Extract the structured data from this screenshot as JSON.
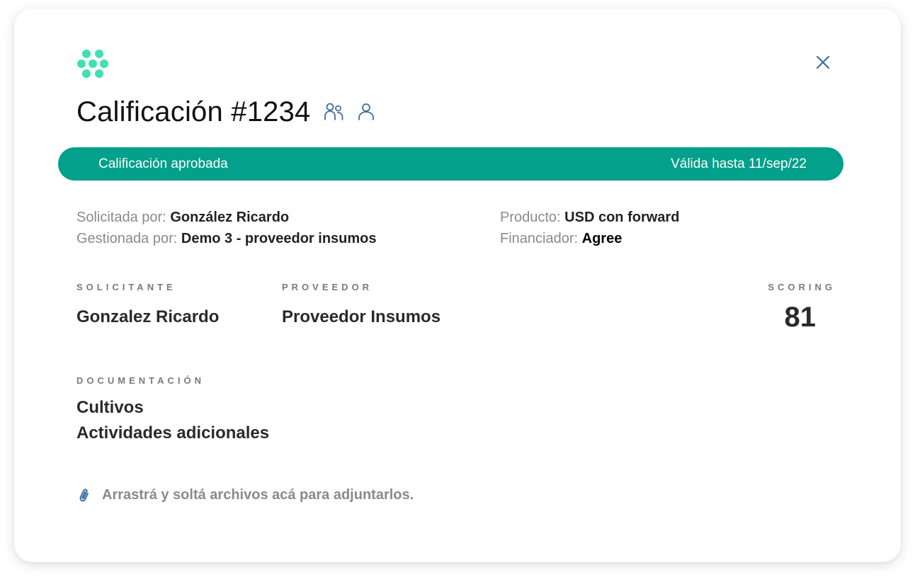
{
  "header": {
    "title": "Calificación #1234",
    "icons": [
      "logo-icon",
      "users-icon",
      "user-icon",
      "close-icon"
    ]
  },
  "status": {
    "label": "Calificación aprobada",
    "validity": "Válida hasta 11/sep/22",
    "color": "#03a08b"
  },
  "meta": {
    "requested_by_label": "Solicitada por:",
    "requested_by_value": "González Ricardo",
    "managed_by_label": "Gestionada por:",
    "managed_by_value": "Demo 3 - proveedor insumos",
    "product_label": "Producto:",
    "product_value": "USD con forward",
    "financer_label": "Financiador:",
    "financer_value": "Agree"
  },
  "parties": {
    "applicant_label": "SOLICITANTE",
    "applicant_value": "Gonzalez Ricardo",
    "provider_label": "PROVEEDOR",
    "provider_value": "Proveedor Insumos",
    "scoring_label": "SCORING",
    "scoring_value": "81"
  },
  "documentation": {
    "label": "DOCUMENTACIÓN",
    "items": [
      {
        "label": "Cultivos"
      },
      {
        "label": "Actividades adicionales"
      }
    ]
  },
  "attachments": {
    "dropzone_text": "Arrastrá y soltá archivos acá para adjuntarlos."
  },
  "colors": {
    "accent": "#03a08b",
    "logo": "#3ee0b4",
    "icon_blue": "#3f6f9e"
  }
}
